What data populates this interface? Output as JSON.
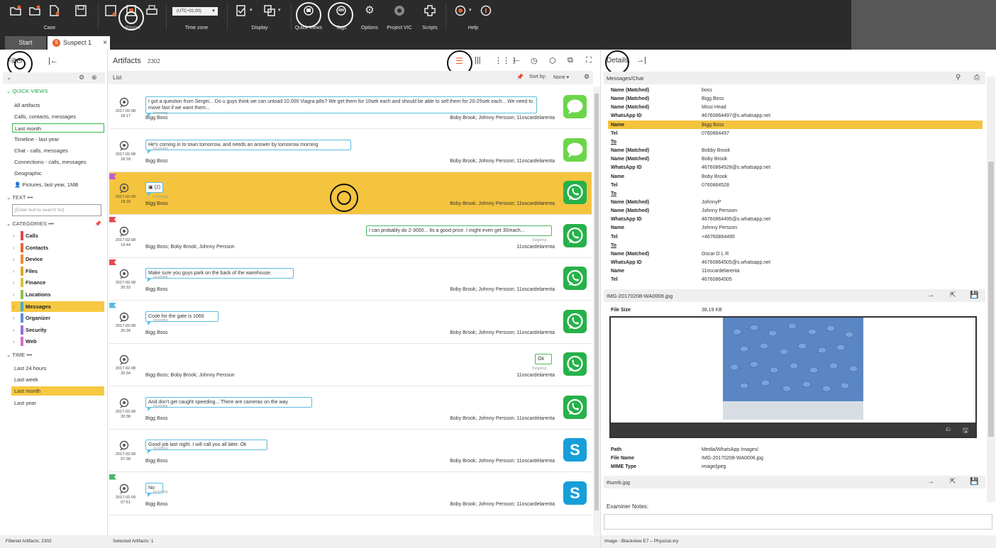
{
  "ribbon": {
    "groups": [
      {
        "label": "Case"
      },
      {
        "label": "Report"
      },
      {
        "label": "Time zone"
      },
      {
        "label": "Display"
      },
      {
        "label": "Quick Views"
      },
      {
        "label": "Tags"
      },
      {
        "label": "Options"
      },
      {
        "label": "Project VIC"
      },
      {
        "label": "Scripts"
      },
      {
        "label": "Help"
      }
    ],
    "timezone_value": "(UTC+01:00)"
  },
  "tabs": {
    "start": "Start",
    "suspect": "Suspect 1",
    "suspect_badge": "S",
    "close": "×"
  },
  "filter": {
    "title": "Filter",
    "quick_views_header": "QUICK VIEWS",
    "quick_views": [
      "All artifacts",
      "Calls, contacts, messages",
      "Last month",
      "Timeline - last year",
      "Chat - calls, messages",
      "Connections - calls, messages",
      "Geographic",
      "Pictures, last year, 1MB"
    ],
    "text_header": "TEXT",
    "search_placeholder": "Enter text to search for",
    "categories_header": "CATEGORIES",
    "categories": [
      {
        "label": "Calls",
        "color": "#e4474f"
      },
      {
        "label": "Contacts",
        "color": "#e8642c"
      },
      {
        "label": "Device",
        "color": "#f08c34"
      },
      {
        "label": "Files",
        "color": "#e0a828"
      },
      {
        "label": "Finance",
        "color": "#d6c43a"
      },
      {
        "label": "Locations",
        "color": "#8bc34a"
      },
      {
        "label": "Messages",
        "color": "#3ab0e0"
      },
      {
        "label": "Organizer",
        "color": "#5b8fd9"
      },
      {
        "label": "Security",
        "color": "#9a6fd6"
      },
      {
        "label": "Web",
        "color": "#d66fc8"
      }
    ],
    "time_header": "TIME",
    "time_items": [
      "Last 24 hours",
      "Last week",
      "Last month",
      "Last year"
    ],
    "footer": "Filtered Artifacts: 2302"
  },
  "artifacts": {
    "title": "Artifacts",
    "count": "2302",
    "list_label": "List",
    "sort_label": "Sort by:",
    "sort_value": "None",
    "footer": "Selected Artifacts: 1",
    "rows": [
      {
        "flag": "",
        "date": "2017-02-08",
        "time": "18:17",
        "text": "I got a question from Sergei... Do u guys think we can unload 10.000 Viagra pills? We get them for 10sek each and should be able to sell them for 20-25sek each... We need to move fast if we want them...",
        "direction": "Incoming",
        "from": "Bigg Boss",
        "participants": "Boby Brook; Johnny Persson; 11oscardelarenta",
        "app": "msg"
      },
      {
        "flag": "",
        "date": "2017-02-08",
        "time": "18:18",
        "text": "He's coming in to town tomorrow, and needs an answer by tomorrow morning",
        "direction": "Incoming",
        "from": "Bigg Boss",
        "participants": "Boby Brook; Johnny Persson; 11oscardelarenta",
        "app": "msg"
      },
      {
        "flag": "#c35bd6",
        "date": "2017-02-08",
        "time": "18:18",
        "text": "(2)",
        "direction": "Incoming",
        "from": "Bigg Boss",
        "participants": "Boby Brook; Johnny Persson; 11oscardelarenta",
        "app": "wa"
      },
      {
        "flag": "#e4474f",
        "date": "2017-02-08",
        "time": "19:44",
        "text": "I can probably do 2-3000... Its a good price. I might even get 30/each...",
        "direction": "Outgoing",
        "from": "Bigg Boss; Boby Brook; Johnny Persson",
        "participants": "11oscardelarenta",
        "app": "wa"
      },
      {
        "flag": "#e4474f",
        "date": "2017-02-08",
        "time": "20:33",
        "text": "Make sure you guys park on the back of the warehouse.",
        "direction": "Incoming",
        "from": "Bigg Boss",
        "participants": "Boby Brook; Johnny Persson; 11oscardelarenta",
        "app": "wa"
      },
      {
        "flag": "#5bbde0",
        "date": "2017-02-08",
        "time": "20:34",
        "text": "Code for the gate is 1066",
        "direction": "Incoming",
        "from": "Bigg Boss",
        "participants": "Boby Brook; Johnny Persson; 11oscardelarenta",
        "app": "wa"
      },
      {
        "flag": "",
        "date": "2017-02-08",
        "time": "20:34",
        "text": "Ok",
        "direction": "Outgoing",
        "from": "Bigg Boss; Boby Brook; Johnny Persson",
        "participants": "11oscardelarenta",
        "app": "wa"
      },
      {
        "flag": "",
        "date": "2017-02-08",
        "time": "20:38",
        "text": "And don't get caught speeding... There are cameras on the way",
        "direction": "Incoming",
        "from": "Bigg Boss",
        "participants": "Boby Brook; Johnny Persson; 11oscardelarenta",
        "app": "wa"
      },
      {
        "flag": "",
        "date": "2017-02-09",
        "time": "07:38",
        "text": "Good job last night. I will call you all later. Ok",
        "direction": "Incoming",
        "from": "Bigg Boss",
        "participants": "Boby Brook; Johnny Persson; 11oscardelarenta",
        "app": "sk"
      },
      {
        "flag": "#48b864",
        "date": "2017-02-09",
        "time": "07:51",
        "text": "No",
        "direction": "Incoming",
        "from": "Bigg Boss",
        "participants": "Boby Brook; Johnny Persson; 11oscardelarenta",
        "app": "sk"
      }
    ]
  },
  "details": {
    "title": "Details",
    "section_title": "Messages/Chat",
    "fields": [
      {
        "k": "Name (Matched)",
        "v": "boss"
      },
      {
        "k": "Name (Matched)",
        "v": "Bigg Boss"
      },
      {
        "k": "Name (Matched)",
        "v": "Missi Head"
      },
      {
        "k": "WhatsApp ID",
        "v": "46760864497@s.whatsapp.net"
      },
      {
        "k": "Name",
        "v": "Bigg Boss"
      },
      {
        "k": "Tel",
        "v": "0760864497"
      },
      {
        "k": "To",
        "v": ""
      },
      {
        "k": "Name (Matched)",
        "v": "Bobby Brook"
      },
      {
        "k": "Name (Matched)",
        "v": "Boby Brook"
      },
      {
        "k": "WhatsApp ID",
        "v": "46760864528@s.whatsapp.net"
      },
      {
        "k": "Name",
        "v": "Boby Brook"
      },
      {
        "k": "Tel",
        "v": "0760864528"
      },
      {
        "k": "To",
        "v": ""
      },
      {
        "k": "Name (Matched)",
        "v": "JohnnyP"
      },
      {
        "k": "Name (Matched)",
        "v": "Johnny Persson"
      },
      {
        "k": "WhatsApp ID",
        "v": "46760864495@s.whatsapp.net"
      },
      {
        "k": "Name",
        "v": "Johnny Persson"
      },
      {
        "k": "Tel",
        "v": "+46760864495"
      },
      {
        "k": "To",
        "v": ""
      },
      {
        "k": "Name (Matched)",
        "v": "Oscar D L R"
      },
      {
        "k": "WhatsApp ID",
        "v": "46760864505@s.whatsapp.net"
      },
      {
        "k": "Name",
        "v": "11oscardelarenta"
      },
      {
        "k": "Tel",
        "v": "46760864505"
      }
    ],
    "attachment_title": "IMG-20170208-WA0006.jpg",
    "file_size_label": "File Size",
    "file_size_value": "38,19 KB",
    "path_label": "Path",
    "path_value": "Media/WhatsApp Images/",
    "file_name_label": "File Name",
    "file_name_value": "IMG-20170208-WA0006.jpg",
    "mime_label": "MIME Type",
    "mime_value": "image/jpeg",
    "thumb_title": "thumb.jpg",
    "notes_label": "Examiner Notes:",
    "footer": "Image - Blackview E7 – Physical.xry"
  },
  "colors": {
    "selected_row": "#f5c43e",
    "incoming_bubble": "#5bbde0",
    "outgoing_bubble": "#48b864",
    "quick_views_green": "#1aa34a"
  }
}
